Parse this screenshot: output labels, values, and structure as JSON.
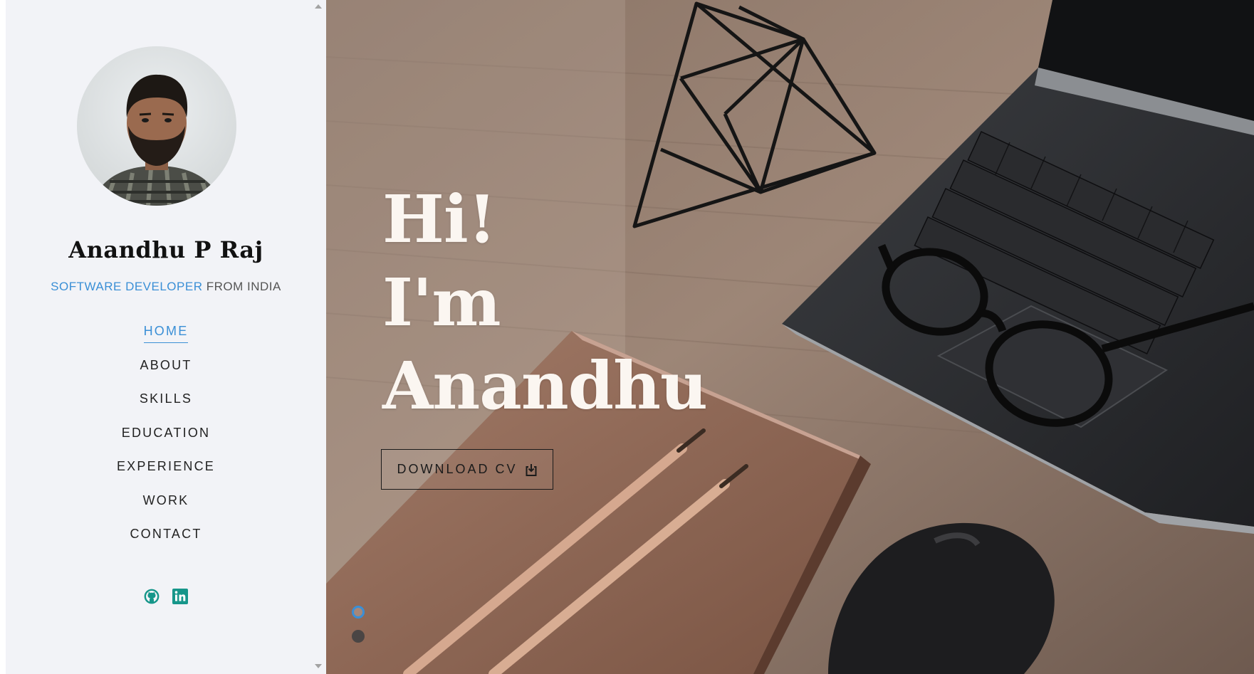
{
  "profile": {
    "name": "Anandhu P Raj",
    "role": "SOFTWARE DEVELOPER",
    "location": "FROM INDIA"
  },
  "nav": [
    {
      "label": "HOME",
      "active": true
    },
    {
      "label": "ABOUT",
      "active": false
    },
    {
      "label": "SKILLS",
      "active": false
    },
    {
      "label": "EDUCATION",
      "active": false
    },
    {
      "label": "EXPERIENCE",
      "active": false
    },
    {
      "label": "WORK",
      "active": false
    },
    {
      "label": "CONTACT",
      "active": false
    }
  ],
  "social": [
    {
      "icon": "github-icon"
    },
    {
      "icon": "linkedin-icon"
    }
  ],
  "hero": {
    "line1": "Hi!",
    "line2": "I'm",
    "line3": "Anandhu",
    "cv_button": "DOWNLOAD CV",
    "slides": 2,
    "active_slide": 1
  },
  "colors": {
    "accent": "#3a8fd6",
    "sidebar_bg": "#f2f3f7",
    "social_icon": "#16968a",
    "hero_text": "#fbf6f1"
  }
}
